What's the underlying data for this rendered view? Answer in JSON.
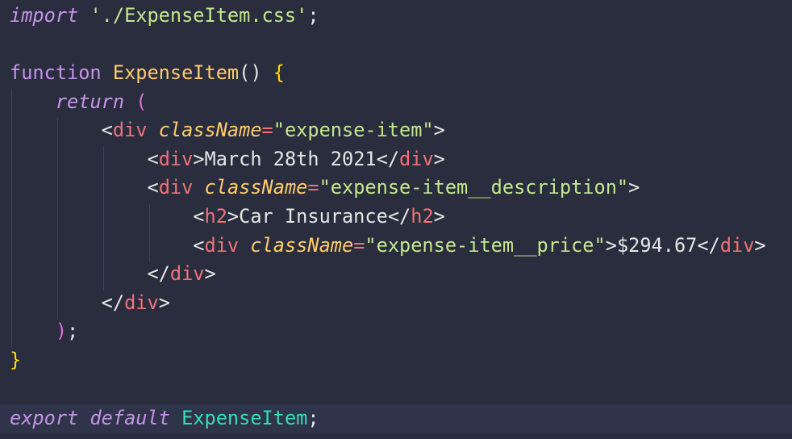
{
  "editor": {
    "language": "jsx",
    "lines": {
      "l1": {
        "kw_import": "import",
        "sp1": " ",
        "str_path": "'./ExpenseItem.css'",
        "semi": ";"
      },
      "l3": {
        "kw_function": "function",
        "sp1": " ",
        "fn_name": "ExpenseItem",
        "parens": "()",
        "sp2": " ",
        "brace_open": "{"
      },
      "l4": {
        "indent": "    ",
        "kw_return": "return",
        "sp1": " ",
        "paren_open": "("
      },
      "l5": {
        "indent": "        ",
        "lt": "<",
        "tag": "div",
        "sp1": " ",
        "attr": "className",
        "eq": "=",
        "val": "\"expense-item\"",
        "gt": ">"
      },
      "l6": {
        "indent": "            ",
        "lt": "<",
        "tag": "div",
        "gt": ">",
        "text": "March 28th 2021",
        "lt2": "</",
        "tag2": "div",
        "gt2": ">"
      },
      "l7": {
        "indent": "            ",
        "lt": "<",
        "tag": "div",
        "sp1": " ",
        "attr": "className",
        "eq": "=",
        "val": "\"expense-item__description\"",
        "gt": ">"
      },
      "l8": {
        "indent": "                ",
        "lt": "<",
        "tag": "h2",
        "gt": ">",
        "text": "Car Insurance",
        "lt2": "</",
        "tag2": "h2",
        "gt2": ">"
      },
      "l9": {
        "indent": "                ",
        "lt": "<",
        "tag": "div",
        "sp1": " ",
        "attr": "className",
        "eq": "=",
        "val": "\"expense-item__price\"",
        "gt": ">",
        "text": "$294.67",
        "lt2": "</",
        "tag2": "div",
        "gt2": ">"
      },
      "l10": {
        "indent": "            ",
        "lt": "</",
        "tag": "div",
        "gt": ">"
      },
      "l11": {
        "indent": "        ",
        "lt": "</",
        "tag": "div",
        "gt": ">"
      },
      "l12": {
        "indent": "    ",
        "paren_close": ")",
        "semi": ";"
      },
      "l13": {
        "brace_close": "}"
      },
      "l15": {
        "kw_export": "export",
        "sp1": " ",
        "kw_default": "default",
        "sp2": " ",
        "ident": "ExpenseItem",
        "semi": ";"
      }
    },
    "colors": {
      "background": "#292d3e",
      "keyword": "#c792ea",
      "function_name": "#ffcb6b",
      "string": "#c3e88d",
      "tag_name": "#f07178",
      "identifier": "#2fe0b8",
      "bracket": "#ffd700"
    }
  }
}
